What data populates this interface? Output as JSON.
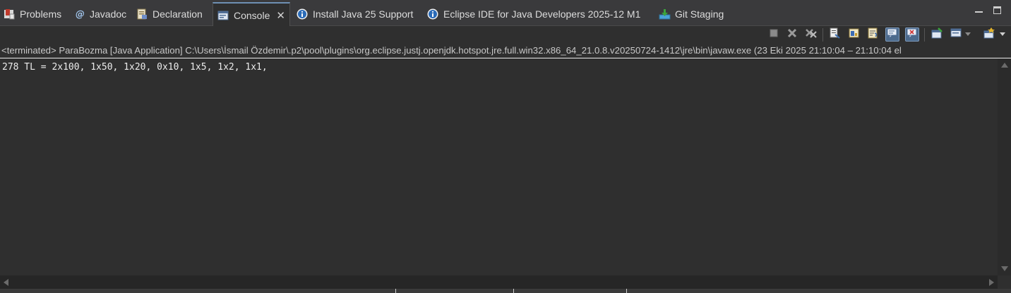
{
  "tabs": [
    {
      "label": "Problems",
      "icon": "problems-icon"
    },
    {
      "label": "Javadoc",
      "icon": "javadoc-icon"
    },
    {
      "label": "Declaration",
      "icon": "declaration-icon"
    },
    {
      "label": "Console",
      "icon": "console-icon",
      "active": true
    },
    {
      "label": "Install Java 25 Support",
      "icon": "info-icon"
    },
    {
      "label": "Eclipse IDE for Java Developers 2025-12 M1",
      "icon": "info-icon"
    },
    {
      "label": "Git Staging",
      "icon": "git-staging-icon"
    }
  ],
  "toolbar": {
    "buttons": [
      "terminate-icon",
      "remove-launch-icon",
      "remove-all-terminated-icon",
      "clear-console-icon",
      "scroll-lock-icon",
      "word-wrap-icon",
      "show-on-stdout-icon",
      "show-on-stderr-icon",
      "pin-console-icon",
      "display-selected-console-icon",
      "open-console-icon"
    ]
  },
  "process_line": "<terminated> ParaBozma [Java Application] C:\\Users\\İsmail Özdemir\\.p2\\pool\\plugins\\org.eclipse.justj.openjdk.hotspot.jre.full.win32.x86_64_21.0.8.v20250724-1412\\jre\\bin\\javaw.exe  (23 Eki 2025 21:10:04 – 21:10:04 el",
  "console_output": "278 TL = 2x100, 1x50, 1x20, 0x10, 1x5, 1x2, 1x1,",
  "colors": {
    "accent": "#6e8fb3",
    "background": "#2f2f2f",
    "text": "#ececec"
  }
}
